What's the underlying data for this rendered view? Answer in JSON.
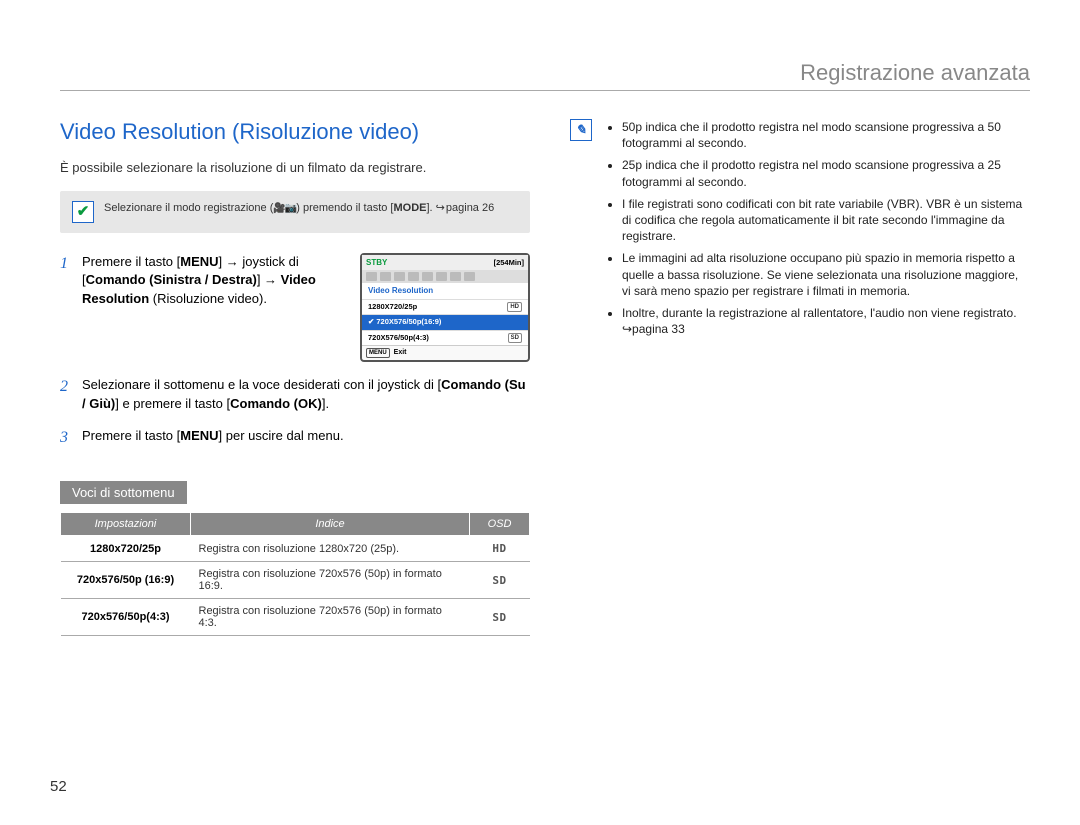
{
  "header": {
    "section": "Registrazione avanzata"
  },
  "title": "Video Resolution (Risoluzione video)",
  "intro": "È possibile selezionare la risoluzione di un filmato da registrare.",
  "note": {
    "text_a": "Selezionare il modo registrazione (",
    "text_b": ") premendo il tasto [",
    "mode_label": "MODE",
    "text_c": "]. ",
    "page_ref": "pagina 26"
  },
  "steps": {
    "s1": {
      "a": "Premere il tasto [",
      "menu": "MENU",
      "b": "] → joystick di [",
      "cmd_lr": "Comando (Sinistra / Destra)",
      "c": "] → ",
      "vr": "Video Resolution",
      "d": " (Risoluzione video)."
    },
    "s2": {
      "a": "Selezionare il sottomenu e la voce desiderati con il joystick di [",
      "cmd_ud": "Comando (Su / Giù)",
      "b": "] e premere il tasto [",
      "cmd_ok": "Comando (OK)",
      "c": "]."
    },
    "s3": {
      "a": "Premere il tasto [",
      "menu": "MENU",
      "b": "] per uscire dal menu."
    }
  },
  "lcd": {
    "stby": "STBY",
    "time": "[254Min]",
    "title": "Video Resolution",
    "r1": "1280X720/25p",
    "r1_badge": "HD",
    "r2": "720X576/50p(16:9)",
    "r3": "720X576/50p(4:3)",
    "r3_badge": "SD",
    "menu_btn": "MENU",
    "exit": "Exit"
  },
  "submenu_heading": "Voci di sottomenu",
  "table": {
    "h1": "Impostazioni",
    "h2": "Indice",
    "h3": "OSD",
    "rows": [
      {
        "setting": "1280x720/25p",
        "desc": "Registra con risoluzione 1280x720 (25p).",
        "osd": "HD"
      },
      {
        "setting": "720x576/50p (16:9)",
        "desc": "Registra con risoluzione 720x576 (50p) in formato 16:9.",
        "osd": "SD"
      },
      {
        "setting": "720x576/50p(4:3)",
        "desc": "Registra con risoluzione 720x576 (50p) in formato 4:3.",
        "osd": "SD"
      }
    ]
  },
  "info_bullets": [
    "50p indica che il prodotto registra nel modo scansione progressiva a 50 fotogrammi al secondo.",
    "25p indica che il prodotto registra nel modo scansione progressiva a 25 fotogrammi al secondo.",
    "I file registrati sono codificati con bit rate variabile (VBR). VBR è un sistema di codifica che regola automaticamente il bit rate secondo l'immagine da registrare.",
    "Le immagini ad alta risoluzione occupano più spazio in memoria rispetto a quelle a bassa risoluzione. Se viene selezionata una risoluzione maggiore, vi sarà meno spazio per registrare i filmati in memoria.",
    "Inoltre, durante la registrazione al rallentatore, l'audio non viene registrato. ↪pagina 33"
  ],
  "page_number": "52"
}
